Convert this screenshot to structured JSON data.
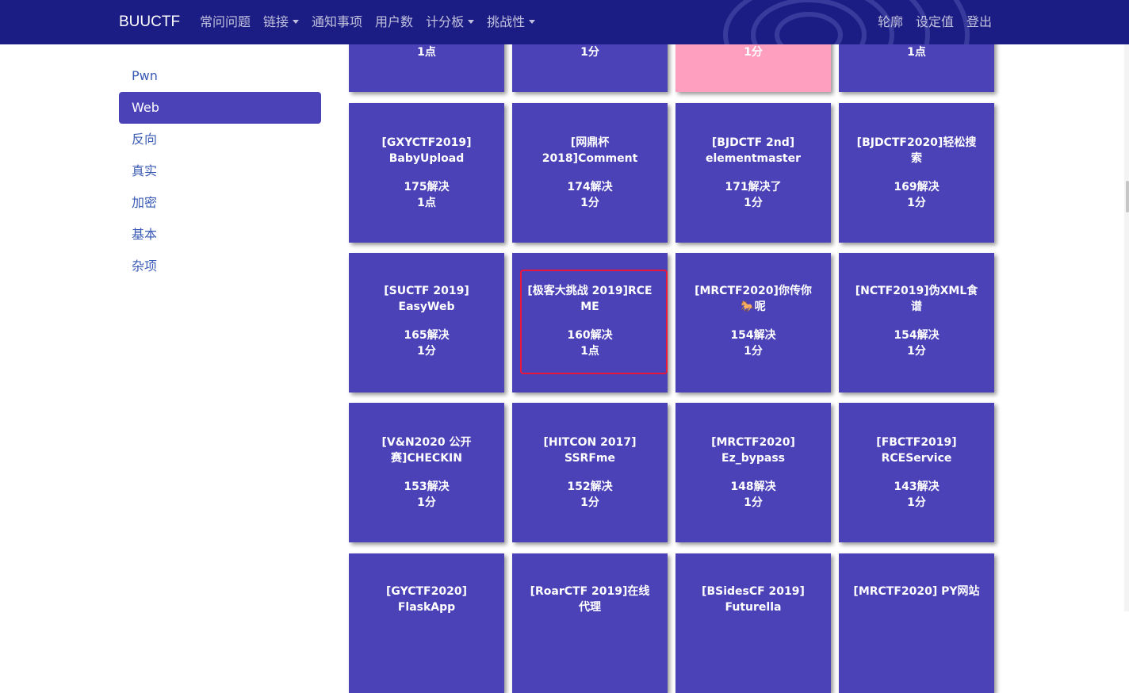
{
  "nav": {
    "brand": "BUUCTF",
    "left": [
      {
        "label": "常问问题",
        "dropdown": false
      },
      {
        "label": "链接",
        "dropdown": true
      },
      {
        "label": "通知事项",
        "dropdown": false
      },
      {
        "label": "用户数",
        "dropdown": false
      },
      {
        "label": "计分板",
        "dropdown": true
      },
      {
        "label": "挑战性",
        "dropdown": true
      }
    ],
    "right": [
      "轮廓",
      "设定值",
      "登出"
    ]
  },
  "sidebar": {
    "items": [
      "Pwn",
      "Web",
      "反向",
      "真实",
      "加密",
      "基本",
      "杂项"
    ],
    "active": "Web"
  },
  "challenges": [
    {
      "title": "",
      "solves": "",
      "points": "1点",
      "color": "#4b42b8"
    },
    {
      "title": "",
      "solves": "",
      "points": "1分",
      "color": "#4b42b8"
    },
    {
      "title": "",
      "solves": "",
      "points": "1分",
      "color": "#ff9fbf"
    },
    {
      "title": "",
      "solves": "",
      "points": "1点",
      "color": "#4b42b8"
    },
    {
      "title": "[GXYCTF2019] BabyUpload",
      "solves": "175解决",
      "points": "1点"
    },
    {
      "title": "[网鼎杯 2018]Comment",
      "solves": "174解决",
      "points": "1分"
    },
    {
      "title": "[BJDCTF 2nd] elementmaster",
      "solves": "171解决了",
      "points": "1分"
    },
    {
      "title": "[BJDCTF2020]轻松搜索",
      "solves": "169解决",
      "points": "1分"
    },
    {
      "title": "[SUCTF 2019] EasyWeb",
      "solves": "165解决",
      "points": "1分"
    },
    {
      "title": "[极客大挑战 2019]RCE ME",
      "solves": "160解决",
      "points": "1点"
    },
    {
      "title": "[MRCTF2020]你传你🐎呢",
      "solves": "154解决",
      "points": "1分"
    },
    {
      "title": "[NCTF2019]伪XML食谱",
      "solves": "154解决",
      "points": "1分"
    },
    {
      "title": "[V&N2020 公开赛]CHECKIN",
      "solves": "153解决",
      "points": "1分"
    },
    {
      "title": "[HITCON 2017] SSRFme",
      "solves": "152解决",
      "points": "1分"
    },
    {
      "title": "[MRCTF2020] Ez_bypass",
      "solves": "148解决",
      "points": "1分"
    },
    {
      "title": "[FBCTF2019] RCEService",
      "solves": "143解决",
      "points": "1分"
    },
    {
      "title": "[GYCTF2020] FlaskApp",
      "solves": "",
      "points": ""
    },
    {
      "title": "[RoarCTF 2019]在线代理",
      "solves": "",
      "points": ""
    },
    {
      "title": "[BSidesCF 2019] Futurella",
      "solves": "",
      "points": ""
    },
    {
      "title": "[MRCTF2020] PY网站",
      "solves": "",
      "points": ""
    }
  ]
}
